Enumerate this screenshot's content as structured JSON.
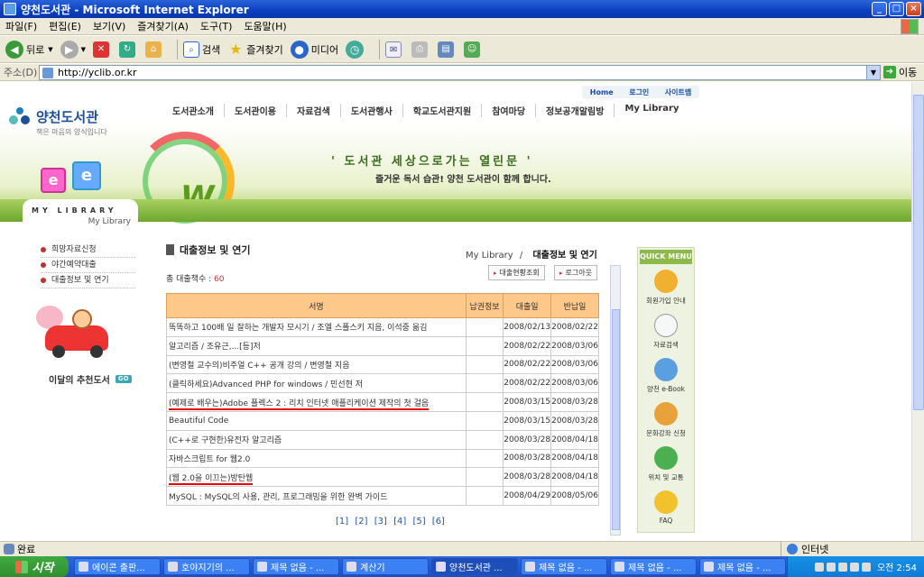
{
  "window": {
    "title": "양천도서관 - Microsoft Internet Explorer",
    "min": "_",
    "max": "□",
    "close": "×"
  },
  "menu": [
    "파일(F)",
    "편집(E)",
    "보기(V)",
    "즐겨찾기(A)",
    "도구(T)",
    "도움말(H)"
  ],
  "toolbar": {
    "back": "뒤로",
    "search": "검색",
    "favorites": "즐겨찾기",
    "media": "미디어"
  },
  "address": {
    "label": "주소(D)",
    "url": "http://yclib.or.kr",
    "go": "이동"
  },
  "site": {
    "util": [
      "Home",
      "로그인",
      "사이트맵"
    ],
    "logo_title": "양천도서관",
    "logo_sub": "책은 마음의 양식입니다",
    "gnb": [
      "도서관소개",
      "도서관이용",
      "자료검색",
      "도서관행사",
      "학교도서관지원",
      "참여마당",
      "정보공개알림방",
      "My Library"
    ],
    "slogan": "' 도서관 세상으로가는 열린문 '",
    "slogan2": "즐거운 독서 습관! 양천 도서관이 함께 합니다.",
    "mylib_a": "MY LIBRARY",
    "mylib_b": "My Library",
    "lnb": [
      "희망자료신청",
      "야간예약대출",
      "대출정보 및 연기"
    ],
    "rec_label": "이달의 추천도서",
    "rec_go": "GO",
    "page_title": "대출정보 및 연기",
    "crumb_a": "My Library",
    "crumb_sep": "/",
    "crumb_b": "대출정보 및 연기",
    "total_label": "총 대출책수 : ",
    "total_value": "60",
    "btn_loan": "대출현황조회",
    "btn_logout": "로그아웃",
    "cols": [
      "서명",
      "납권정보",
      "대출일",
      "반납일"
    ],
    "rows": [
      {
        "t": "똑똑하고 100배 일 잘하는 개발자 모시기 / 조엘 스폴스키 지음, 이석중 옮김",
        "i": "",
        "d": "2008/02/13",
        "r": "2008/02/22"
      },
      {
        "t": "알고리즘 / 조유근,...[등]저",
        "i": "",
        "d": "2008/02/22",
        "r": "2008/03/06"
      },
      {
        "t": "(변영철 교수의)비주얼 C++ 공개 강의 / 변영철 지음",
        "i": "",
        "d": "2008/02/22",
        "r": "2008/03/06"
      },
      {
        "t": "(클릭하세요)Advanced PHP for windows / 민선현 저",
        "i": "",
        "d": "2008/02/22",
        "r": "2008/03/06"
      },
      {
        "t": "(예제로 배우는)Adobe 플렉스 2 : 리치 인터넷 애플리케이션 제작의 첫 걸음",
        "i": "",
        "d": "2008/03/15",
        "r": "2008/03/28"
      },
      {
        "t": "Beautiful Code",
        "i": "",
        "d": "2008/03/15",
        "r": "2008/03/28"
      },
      {
        "t": "(C++로 구현한)유전자 알고리즘",
        "i": "",
        "d": "2008/03/28",
        "r": "2008/04/18"
      },
      {
        "t": "자바스크립트 for 웹2.0",
        "i": "",
        "d": "2008/03/28",
        "r": "2008/04/18"
      },
      {
        "t": "(웹 2.0을 이끄는)방탄웹",
        "i": "",
        "d": "2008/03/28",
        "r": "2008/04/18"
      },
      {
        "t": "MySQL : MySQL의 사용, 관리, 프로그래밍을 위한 완벽 가이드",
        "i": "",
        "d": "2008/04/29",
        "r": "2008/05/06"
      }
    ],
    "pages": [
      "[1]",
      "[2]",
      "[3]",
      "[4]",
      "[5]",
      "[6]"
    ],
    "quick_title": "QUICK MENU",
    "quick": [
      "회원가입 안내",
      "자료검색",
      "양천 e-Book",
      "문화강좌 신청",
      "위치 및 교통",
      "FAQ"
    ]
  },
  "status": {
    "text": "완료",
    "zone": "인터넷"
  },
  "taskbar": {
    "start": "시작",
    "tasks": [
      "에이콘 출판...",
      "호야지기의 ...",
      "제목 없음 - ...",
      "계산기",
      "양천도서관 ...",
      "제목 없음 - ...",
      "제목 없음 - ...",
      "제목 없음 - ..."
    ],
    "clock": "오전 2:54"
  }
}
